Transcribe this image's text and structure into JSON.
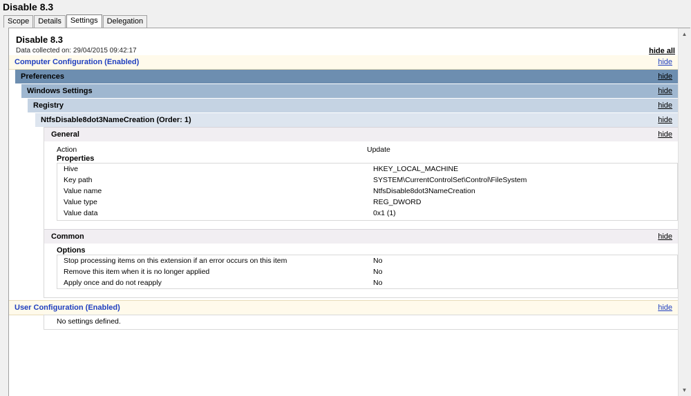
{
  "window": {
    "title": "Disable 8.3"
  },
  "tabs": [
    "Scope",
    "Details",
    "Settings",
    "Delegation"
  ],
  "report": {
    "title": "Disable 8.3",
    "collected": "Data collected on: 29/04/2015 09:42:17",
    "hide_all": "hide all"
  },
  "hide_label": "hide",
  "computer_config": "Computer Configuration (Enabled)",
  "preferences": "Preferences",
  "windows_settings": "Windows Settings",
  "registry": "Registry",
  "item": "NtfsDisable8dot3NameCreation (Order: 1)",
  "general": {
    "heading": "General",
    "action_label": "Action",
    "action_value": "Update",
    "properties_heading": "Properties",
    "properties": [
      {
        "name": "Hive",
        "value": "HKEY_LOCAL_MACHINE"
      },
      {
        "name": "Key path",
        "value": "SYSTEM\\CurrentControlSet\\Control\\FileSystem"
      },
      {
        "name": "Value name",
        "value": "NtfsDisable8dot3NameCreation"
      },
      {
        "name": "Value type",
        "value": "REG_DWORD"
      },
      {
        "name": "Value data",
        "value": "0x1 (1)"
      }
    ]
  },
  "common": {
    "heading": "Common",
    "options_heading": "Options",
    "options": [
      {
        "name": "Stop processing items on this extension if an error occurs on this item",
        "value": "No"
      },
      {
        "name": "Remove this item when it is no longer applied",
        "value": "No"
      },
      {
        "name": "Apply once and do not reapply",
        "value": "No"
      }
    ]
  },
  "user_config": "User Configuration (Enabled)",
  "no_settings": "No settings defined."
}
